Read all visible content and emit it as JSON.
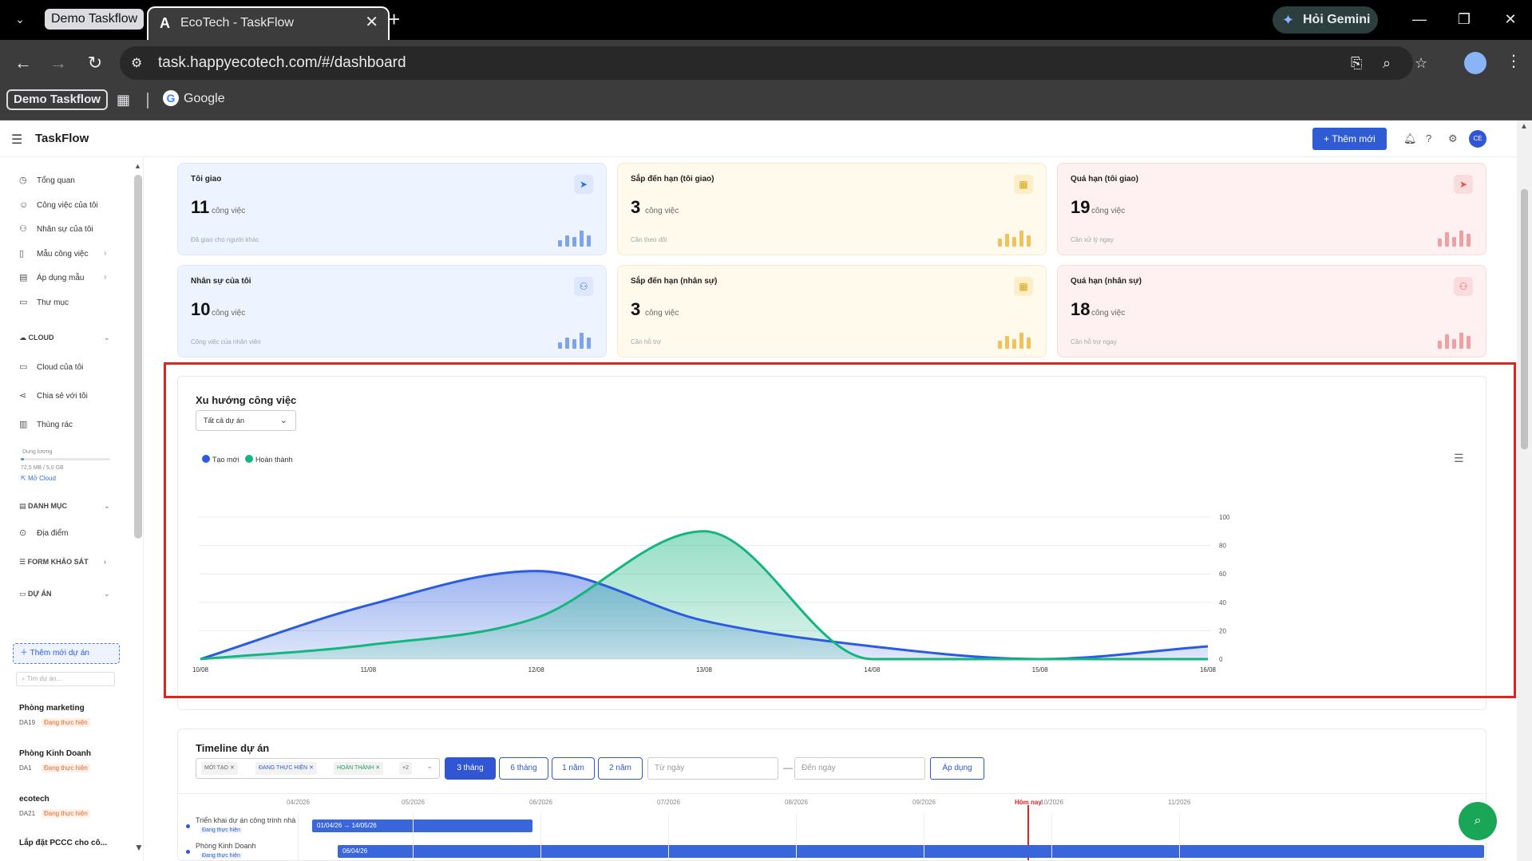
{
  "browser": {
    "tab_group": "Demo Taskflow",
    "tab_title": "EcoTech - TaskFlow",
    "gemini_label": "Hỏi Gemini",
    "url": "task.happyecotech.com/#/dashboard",
    "bookmark_group": "Demo Taskflow",
    "bookmark_google": "Google"
  },
  "app": {
    "title": "TaskFlow",
    "add_new": "+ Thêm mới",
    "avatar_initials": "CE"
  },
  "sidebar": {
    "items": [
      {
        "label": "Tổng quan",
        "icon": "clock-icon"
      },
      {
        "label": "Công việc của tôi",
        "icon": "user-icon"
      },
      {
        "label": "Nhân sự của tôi",
        "icon": "users-icon"
      },
      {
        "label": "Mẫu công việc",
        "icon": "file-icon"
      },
      {
        "label": "Áp dụng mẫu",
        "icon": "document-icon"
      },
      {
        "label": "Thư mục",
        "icon": "folder-icon"
      }
    ],
    "cloud_section": "CLOUD",
    "cloud_items": [
      {
        "label": "Cloud của tôi",
        "icon": "folder-icon"
      },
      {
        "label": "Chia sẻ với tôi",
        "icon": "share-icon"
      },
      {
        "label": "Thùng rác",
        "icon": "trash-icon"
      }
    ],
    "storage_label": "Dung lượng",
    "storage_text": "72,5 MB / 5,0 GB",
    "storage_fraction": 0.014,
    "storage_link": "Mở Cloud",
    "catalog_section": "DANH MỤC",
    "catalog_items": [
      {
        "label": "Địa điểm",
        "icon": "location-icon"
      }
    ],
    "survey_section": "FORM KHẢO SÁT",
    "projects_section": "DỰ ÁN",
    "new_project": "Thêm mới dự án",
    "search_project_placeholder": "Tìm dự án...",
    "projects": [
      {
        "name": "Phòng marketing",
        "code": "DA19",
        "status": "Đang thực hiện"
      },
      {
        "name": "Phòng Kinh Doanh",
        "code": "DA1",
        "status": "Đang thực hiện"
      },
      {
        "name": "ecotech",
        "code": "DA21",
        "status": "Đang thực hiện"
      },
      {
        "name": "Lắp đặt PCCC cho cô...",
        "code": "",
        "status": ""
      }
    ]
  },
  "cards": [
    {
      "title": "Tôi giao",
      "value": "11",
      "unit": "công việc",
      "sub": "Đã giao cho người khác",
      "tone": "blue",
      "icon": "send-icon"
    },
    {
      "title": "Sắp đến hạn (tôi giao)",
      "value": "3",
      "unit": "công việc",
      "sub": "Cần theo dõi",
      "tone": "yellow",
      "icon": "calendar-icon"
    },
    {
      "title": "Quá hạn (tôi giao)",
      "value": "19",
      "unit": "công việc",
      "sub": "Cần xử lý ngay",
      "tone": "red",
      "icon": "send-icon"
    },
    {
      "title": "Nhân sự của tôi",
      "value": "10",
      "unit": "công việc",
      "sub": "Công việc của nhân viên",
      "tone": "blue",
      "icon": "users-icon"
    },
    {
      "title": "Sắp đến hạn (nhân sự)",
      "value": "3",
      "unit": "công việc",
      "sub": "Cần hỗ trợ",
      "tone": "yellow",
      "icon": "calendar-icon"
    },
    {
      "title": "Quá hạn (nhân sự)",
      "value": "18",
      "unit": "công việc",
      "sub": "Cần hỗ trợ ngay",
      "tone": "red",
      "icon": "users-icon"
    }
  ],
  "trend": {
    "title": "Xu hướng công việc",
    "filter": "Tất cả dự án"
  },
  "chart_data": {
    "type": "area",
    "x": [
      "10/08",
      "11/08",
      "12/08",
      "13/08",
      "14/08",
      "15/08",
      "16/08"
    ],
    "series": [
      {
        "name": "Tạo mới",
        "color": "#2b5ce0",
        "values": [
          0,
          38,
          62,
          27,
          9,
          0,
          9
        ]
      },
      {
        "name": "Hoàn thành",
        "color": "#17b57e",
        "values": [
          0,
          10,
          29,
          90,
          0,
          0,
          0
        ]
      }
    ],
    "yticks": [
      0,
      20,
      40,
      60,
      80,
      100
    ],
    "ylim": [
      0,
      100
    ],
    "grid": true,
    "legend": "top-left",
    "yaxis_side": "right"
  },
  "timeline": {
    "title": "Timeline dự án",
    "tags": [
      "MỚI TẠO",
      "ĐANG THỰC HIỆN",
      "HOÀN THÀNH",
      "+2"
    ],
    "ranges": [
      "3 tháng",
      "6 tháng",
      "1 năm",
      "2 năm"
    ],
    "from_placeholder": "Từ ngày",
    "to_placeholder": "Đến ngày",
    "apply": "Áp dụng",
    "months": [
      "04/2026",
      "05/2026",
      "06/2026",
      "07/2026",
      "08/2026",
      "09/2026",
      "10/2026",
      "11/2026"
    ],
    "today_label": "Hôm nay",
    "rows": [
      {
        "name": "Triển khai dự án công trình nhà",
        "status": "Đang thực hiện",
        "bar": "01/04/26 → 14/05/26"
      },
      {
        "name": "Phòng Kinh Doanh",
        "status": "Đang thực hiện",
        "bar": "06/04/26"
      }
    ]
  }
}
